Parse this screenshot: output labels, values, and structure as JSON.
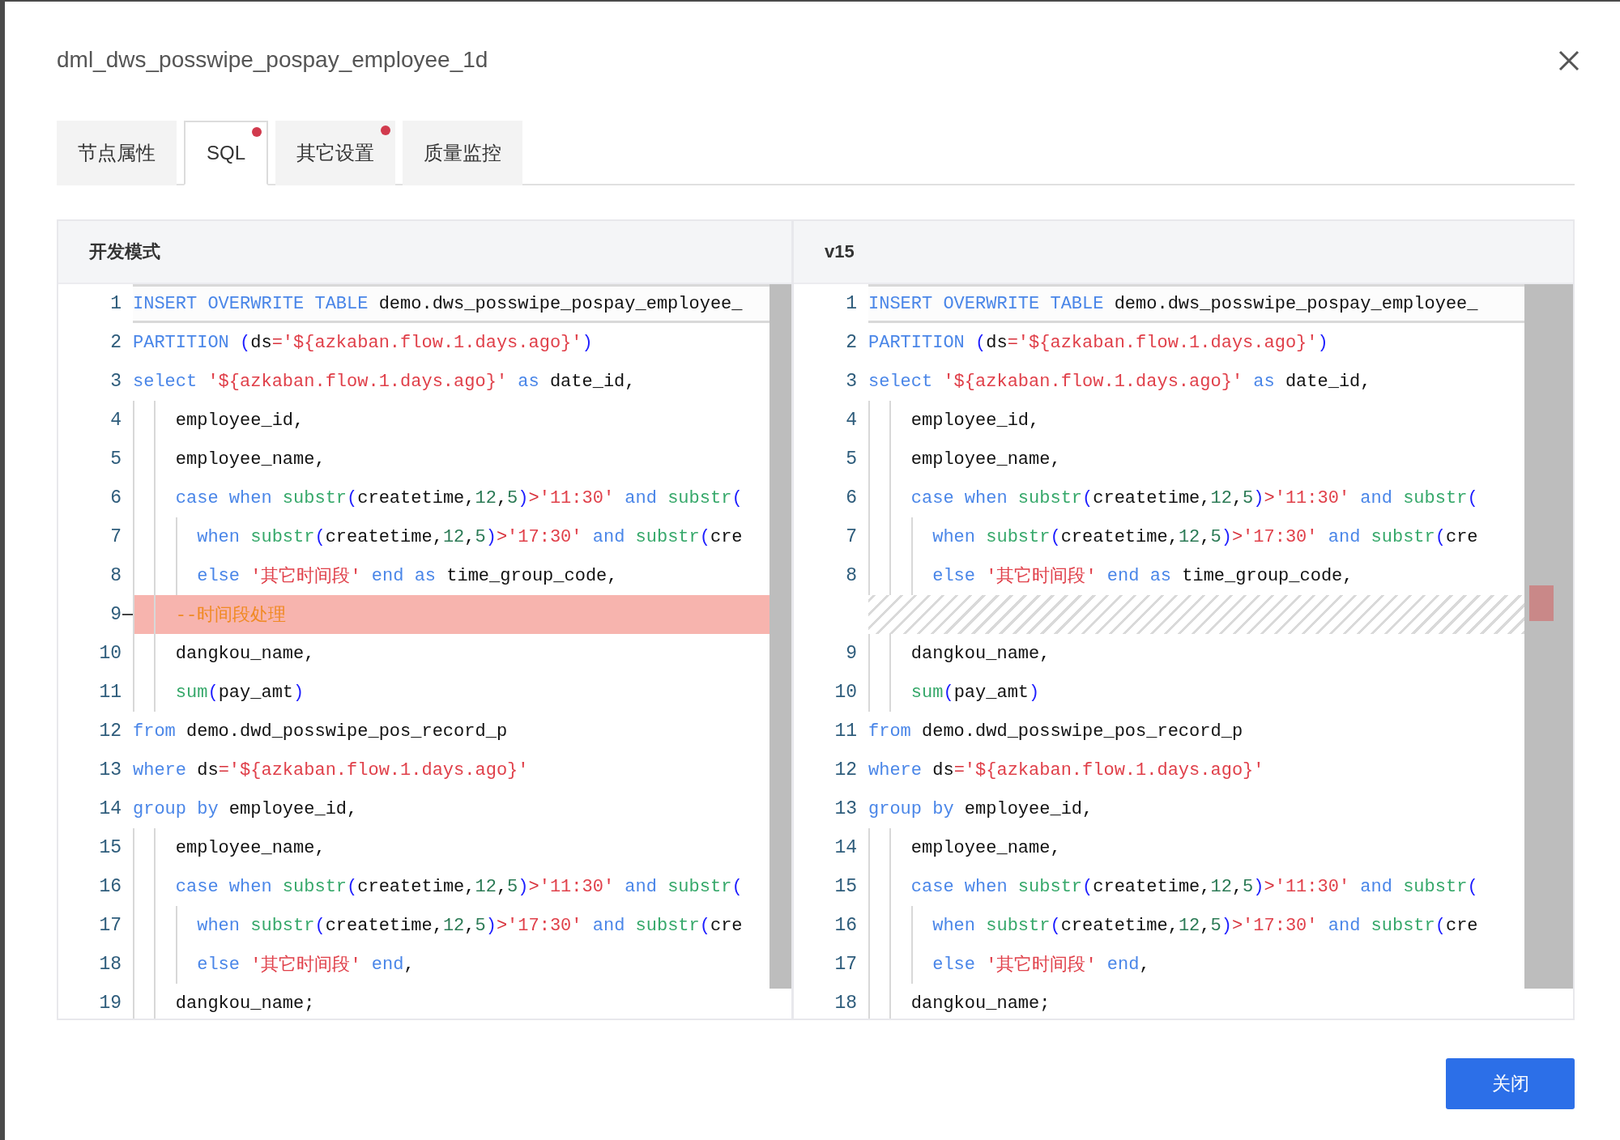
{
  "dialog": {
    "title": "dml_dws_posswipe_pospay_employee_1d",
    "close_button": "关闭"
  },
  "tabs": [
    {
      "label": "节点属性",
      "selected": false,
      "modified": false
    },
    {
      "label": "SQL",
      "selected": true,
      "modified": true
    },
    {
      "label": "其它设置",
      "selected": false,
      "modified": true
    },
    {
      "label": "质量监控",
      "selected": false,
      "modified": false
    }
  ],
  "diff": {
    "panes": [
      {
        "header": "开发模式",
        "lines": [
          {
            "kind": "normal",
            "number": "1",
            "current": true,
            "tokens": [
              {
                "kind": "keyword",
                "text": "INSERT OVERWRITE TABLE"
              },
              {
                "kind": "identifier",
                "text": " demo.dws_posswipe_pospay_employee_"
              }
            ]
          },
          {
            "kind": "normal",
            "number": "2",
            "current": false,
            "tokens": [
              {
                "kind": "keyword",
                "text": "PARTITION "
              },
              {
                "kind": "paren",
                "text": "("
              },
              {
                "kind": "identifier",
                "text": "ds"
              },
              {
                "kind": "operator",
                "text": "="
              },
              {
                "kind": "string",
                "text": "'${azkaban.flow.1.days.ago}'"
              },
              {
                "kind": "paren",
                "text": ")"
              }
            ]
          },
          {
            "kind": "normal",
            "number": "3",
            "current": false,
            "tokens": [
              {
                "kind": "keyword",
                "text": "select "
              },
              {
                "kind": "string",
                "text": "'${azkaban.flow.1.days.ago}'"
              },
              {
                "kind": "keyword",
                "text": " as"
              },
              {
                "kind": "identifier",
                "text": " date_id,"
              }
            ]
          },
          {
            "kind": "normal",
            "number": "4",
            "current": false,
            "tokens": [
              {
                "kind": "identifier",
                "text": "    employee_id,"
              }
            ]
          },
          {
            "kind": "normal",
            "number": "5",
            "current": false,
            "tokens": [
              {
                "kind": "identifier",
                "text": "    employee_name,"
              }
            ]
          },
          {
            "kind": "normal",
            "number": "6",
            "current": false,
            "tokens": [
              {
                "kind": "keyword",
                "text": "    case when "
              },
              {
                "kind": "function",
                "text": "substr"
              },
              {
                "kind": "paren",
                "text": "("
              },
              {
                "kind": "identifier",
                "text": "createtime,"
              },
              {
                "kind": "number",
                "text": "12"
              },
              {
                "kind": "identifier",
                "text": ","
              },
              {
                "kind": "number",
                "text": "5"
              },
              {
                "kind": "paren",
                "text": ")"
              },
              {
                "kind": "operator",
                "text": ">"
              },
              {
                "kind": "string",
                "text": "'11:30'"
              },
              {
                "kind": "keyword",
                "text": " and "
              },
              {
                "kind": "function",
                "text": "substr"
              },
              {
                "kind": "paren",
                "text": "("
              }
            ]
          },
          {
            "kind": "normal",
            "number": "7",
            "current": false,
            "tokens": [
              {
                "kind": "keyword",
                "text": "      when "
              },
              {
                "kind": "function",
                "text": "substr"
              },
              {
                "kind": "paren",
                "text": "("
              },
              {
                "kind": "identifier",
                "text": "createtime,"
              },
              {
                "kind": "number",
                "text": "12"
              },
              {
                "kind": "identifier",
                "text": ","
              },
              {
                "kind": "number",
                "text": "5"
              },
              {
                "kind": "paren",
                "text": ")"
              },
              {
                "kind": "operator",
                "text": ">"
              },
              {
                "kind": "string",
                "text": "'17:30'"
              },
              {
                "kind": "keyword",
                "text": " and "
              },
              {
                "kind": "function",
                "text": "substr"
              },
              {
                "kind": "paren",
                "text": "("
              },
              {
                "kind": "identifier",
                "text": "cre"
              }
            ]
          },
          {
            "kind": "normal",
            "number": "8",
            "current": false,
            "tokens": [
              {
                "kind": "keyword",
                "text": "      else "
              },
              {
                "kind": "string",
                "text": "'其它时间段'"
              },
              {
                "kind": "keyword",
                "text": " end as"
              },
              {
                "kind": "identifier",
                "text": " time_group_code,"
              }
            ]
          },
          {
            "kind": "deleted",
            "number": "9",
            "current": false,
            "tokens": [
              {
                "kind": "comment",
                "text": "    --时间段处理"
              }
            ]
          },
          {
            "kind": "normal",
            "number": "10",
            "current": false,
            "tokens": [
              {
                "kind": "identifier",
                "text": "    dangkou_name,"
              }
            ]
          },
          {
            "kind": "normal",
            "number": "11",
            "current": false,
            "tokens": [
              {
                "kind": "function",
                "text": "    sum"
              },
              {
                "kind": "paren",
                "text": "("
              },
              {
                "kind": "identifier",
                "text": "pay_amt"
              },
              {
                "kind": "paren",
                "text": ")"
              }
            ]
          },
          {
            "kind": "normal",
            "number": "12",
            "current": false,
            "tokens": [
              {
                "kind": "keyword",
                "text": "from"
              },
              {
                "kind": "identifier",
                "text": " demo.dwd_posswipe_pos_record_p"
              }
            ]
          },
          {
            "kind": "normal",
            "number": "13",
            "current": false,
            "tokens": [
              {
                "kind": "keyword",
                "text": "where"
              },
              {
                "kind": "identifier",
                "text": " ds"
              },
              {
                "kind": "operator",
                "text": "="
              },
              {
                "kind": "string",
                "text": "'${azkaban.flow.1.days.ago}'"
              }
            ]
          },
          {
            "kind": "normal",
            "number": "14",
            "current": false,
            "tokens": [
              {
                "kind": "keyword",
                "text": "group by"
              },
              {
                "kind": "identifier",
                "text": " employee_id,"
              }
            ]
          },
          {
            "kind": "normal",
            "number": "15",
            "current": false,
            "tokens": [
              {
                "kind": "identifier",
                "text": "    employee_name,"
              }
            ]
          },
          {
            "kind": "normal",
            "number": "16",
            "current": false,
            "tokens": [
              {
                "kind": "keyword",
                "text": "    case when "
              },
              {
                "kind": "function",
                "text": "substr"
              },
              {
                "kind": "paren",
                "text": "("
              },
              {
                "kind": "identifier",
                "text": "createtime,"
              },
              {
                "kind": "number",
                "text": "12"
              },
              {
                "kind": "identifier",
                "text": ","
              },
              {
                "kind": "number",
                "text": "5"
              },
              {
                "kind": "paren",
                "text": ")"
              },
              {
                "kind": "operator",
                "text": ">"
              },
              {
                "kind": "string",
                "text": "'11:30'"
              },
              {
                "kind": "keyword",
                "text": " and "
              },
              {
                "kind": "function",
                "text": "substr"
              },
              {
                "kind": "paren",
                "text": "("
              }
            ]
          },
          {
            "kind": "normal",
            "number": "17",
            "current": false,
            "tokens": [
              {
                "kind": "keyword",
                "text": "      when "
              },
              {
                "kind": "function",
                "text": "substr"
              },
              {
                "kind": "paren",
                "text": "("
              },
              {
                "kind": "identifier",
                "text": "createtime,"
              },
              {
                "kind": "number",
                "text": "12"
              },
              {
                "kind": "identifier",
                "text": ","
              },
              {
                "kind": "number",
                "text": "5"
              },
              {
                "kind": "paren",
                "text": ")"
              },
              {
                "kind": "operator",
                "text": ">"
              },
              {
                "kind": "string",
                "text": "'17:30'"
              },
              {
                "kind": "keyword",
                "text": " and "
              },
              {
                "kind": "function",
                "text": "substr"
              },
              {
                "kind": "paren",
                "text": "("
              },
              {
                "kind": "identifier",
                "text": "cre"
              }
            ]
          },
          {
            "kind": "normal",
            "number": "18",
            "current": false,
            "tokens": [
              {
                "kind": "keyword",
                "text": "      else "
              },
              {
                "kind": "string",
                "text": "'其它时间段'"
              },
              {
                "kind": "keyword",
                "text": " end"
              },
              {
                "kind": "identifier",
                "text": ","
              }
            ]
          },
          {
            "kind": "normal",
            "number": "19",
            "current": false,
            "tokens": [
              {
                "kind": "identifier",
                "text": "    dangkou_name;"
              }
            ]
          }
        ]
      },
      {
        "header": "v15",
        "lines": [
          {
            "kind": "normal",
            "number": "1",
            "current": true,
            "tokens": [
              {
                "kind": "keyword",
                "text": "INSERT OVERWRITE TABLE"
              },
              {
                "kind": "identifier",
                "text": " demo.dws_posswipe_pospay_employee_"
              }
            ]
          },
          {
            "kind": "normal",
            "number": "2",
            "current": false,
            "tokens": [
              {
                "kind": "keyword",
                "text": "PARTITION "
              },
              {
                "kind": "paren",
                "text": "("
              },
              {
                "kind": "identifier",
                "text": "ds"
              },
              {
                "kind": "operator",
                "text": "="
              },
              {
                "kind": "string",
                "text": "'${azkaban.flow.1.days.ago}'"
              },
              {
                "kind": "paren",
                "text": ")"
              }
            ]
          },
          {
            "kind": "normal",
            "number": "3",
            "current": false,
            "tokens": [
              {
                "kind": "keyword",
                "text": "select "
              },
              {
                "kind": "string",
                "text": "'${azkaban.flow.1.days.ago}'"
              },
              {
                "kind": "keyword",
                "text": " as"
              },
              {
                "kind": "identifier",
                "text": " date_id,"
              }
            ]
          },
          {
            "kind": "normal",
            "number": "4",
            "current": false,
            "tokens": [
              {
                "kind": "identifier",
                "text": "    employee_id,"
              }
            ]
          },
          {
            "kind": "normal",
            "number": "5",
            "current": false,
            "tokens": [
              {
                "kind": "identifier",
                "text": "    employee_name,"
              }
            ]
          },
          {
            "kind": "normal",
            "number": "6",
            "current": false,
            "tokens": [
              {
                "kind": "keyword",
                "text": "    case when "
              },
              {
                "kind": "function",
                "text": "substr"
              },
              {
                "kind": "paren",
                "text": "("
              },
              {
                "kind": "identifier",
                "text": "createtime,"
              },
              {
                "kind": "number",
                "text": "12"
              },
              {
                "kind": "identifier",
                "text": ","
              },
              {
                "kind": "number",
                "text": "5"
              },
              {
                "kind": "paren",
                "text": ")"
              },
              {
                "kind": "operator",
                "text": ">"
              },
              {
                "kind": "string",
                "text": "'11:30'"
              },
              {
                "kind": "keyword",
                "text": " and "
              },
              {
                "kind": "function",
                "text": "substr"
              },
              {
                "kind": "paren",
                "text": "("
              }
            ]
          },
          {
            "kind": "normal",
            "number": "7",
            "current": false,
            "tokens": [
              {
                "kind": "keyword",
                "text": "      when "
              },
              {
                "kind": "function",
                "text": "substr"
              },
              {
                "kind": "paren",
                "text": "("
              },
              {
                "kind": "identifier",
                "text": "createtime,"
              },
              {
                "kind": "number",
                "text": "12"
              },
              {
                "kind": "identifier",
                "text": ","
              },
              {
                "kind": "number",
                "text": "5"
              },
              {
                "kind": "paren",
                "text": ")"
              },
              {
                "kind": "operator",
                "text": ">"
              },
              {
                "kind": "string",
                "text": "'17:30'"
              },
              {
                "kind": "keyword",
                "text": " and "
              },
              {
                "kind": "function",
                "text": "substr"
              },
              {
                "kind": "paren",
                "text": "("
              },
              {
                "kind": "identifier",
                "text": "cre"
              }
            ]
          },
          {
            "kind": "normal",
            "number": "8",
            "current": false,
            "tokens": [
              {
                "kind": "keyword",
                "text": "      else "
              },
              {
                "kind": "string",
                "text": "'其它时间段'"
              },
              {
                "kind": "keyword",
                "text": " end as"
              },
              {
                "kind": "identifier",
                "text": " time_group_code,"
              }
            ]
          },
          {
            "kind": "filler"
          },
          {
            "kind": "normal",
            "number": "9",
            "current": false,
            "tokens": [
              {
                "kind": "identifier",
                "text": "    dangkou_name,"
              }
            ]
          },
          {
            "kind": "normal",
            "number": "10",
            "current": false,
            "tokens": [
              {
                "kind": "function",
                "text": "    sum"
              },
              {
                "kind": "paren",
                "text": "("
              },
              {
                "kind": "identifier",
                "text": "pay_amt"
              },
              {
                "kind": "paren",
                "text": ")"
              }
            ]
          },
          {
            "kind": "normal",
            "number": "11",
            "current": false,
            "tokens": [
              {
                "kind": "keyword",
                "text": "from"
              },
              {
                "kind": "identifier",
                "text": " demo.dwd_posswipe_pos_record_p"
              }
            ]
          },
          {
            "kind": "normal",
            "number": "12",
            "current": false,
            "tokens": [
              {
                "kind": "keyword",
                "text": "where"
              },
              {
                "kind": "identifier",
                "text": " ds"
              },
              {
                "kind": "operator",
                "text": "="
              },
              {
                "kind": "string",
                "text": "'${azkaban.flow.1.days.ago}'"
              }
            ]
          },
          {
            "kind": "normal",
            "number": "13",
            "current": false,
            "tokens": [
              {
                "kind": "keyword",
                "text": "group by"
              },
              {
                "kind": "identifier",
                "text": " employee_id,"
              }
            ]
          },
          {
            "kind": "normal",
            "number": "14",
            "current": false,
            "tokens": [
              {
                "kind": "identifier",
                "text": "    employee_name,"
              }
            ]
          },
          {
            "kind": "normal",
            "number": "15",
            "current": false,
            "tokens": [
              {
                "kind": "keyword",
                "text": "    case when "
              },
              {
                "kind": "function",
                "text": "substr"
              },
              {
                "kind": "paren",
                "text": "("
              },
              {
                "kind": "identifier",
                "text": "createtime,"
              },
              {
                "kind": "number",
                "text": "12"
              },
              {
                "kind": "identifier",
                "text": ","
              },
              {
                "kind": "number",
                "text": "5"
              },
              {
                "kind": "paren",
                "text": ")"
              },
              {
                "kind": "operator",
                "text": ">"
              },
              {
                "kind": "string",
                "text": "'11:30'"
              },
              {
                "kind": "keyword",
                "text": " and "
              },
              {
                "kind": "function",
                "text": "substr"
              },
              {
                "kind": "paren",
                "text": "("
              }
            ]
          },
          {
            "kind": "normal",
            "number": "16",
            "current": false,
            "tokens": [
              {
                "kind": "keyword",
                "text": "      when "
              },
              {
                "kind": "function",
                "text": "substr"
              },
              {
                "kind": "paren",
                "text": "("
              },
              {
                "kind": "identifier",
                "text": "createtime,"
              },
              {
                "kind": "number",
                "text": "12"
              },
              {
                "kind": "identifier",
                "text": ","
              },
              {
                "kind": "number",
                "text": "5"
              },
              {
                "kind": "paren",
                "text": ")"
              },
              {
                "kind": "operator",
                "text": ">"
              },
              {
                "kind": "string",
                "text": "'17:30'"
              },
              {
                "kind": "keyword",
                "text": " and "
              },
              {
                "kind": "function",
                "text": "substr"
              },
              {
                "kind": "paren",
                "text": "("
              },
              {
                "kind": "identifier",
                "text": "cre"
              }
            ]
          },
          {
            "kind": "normal",
            "number": "17",
            "current": false,
            "tokens": [
              {
                "kind": "keyword",
                "text": "      else "
              },
              {
                "kind": "string",
                "text": "'其它时间段'"
              },
              {
                "kind": "keyword",
                "text": " end"
              },
              {
                "kind": "identifier",
                "text": ","
              }
            ]
          },
          {
            "kind": "normal",
            "number": "18",
            "current": false,
            "tokens": [
              {
                "kind": "identifier",
                "text": "    dangkou_name;"
              }
            ]
          }
        ]
      }
    ]
  }
}
